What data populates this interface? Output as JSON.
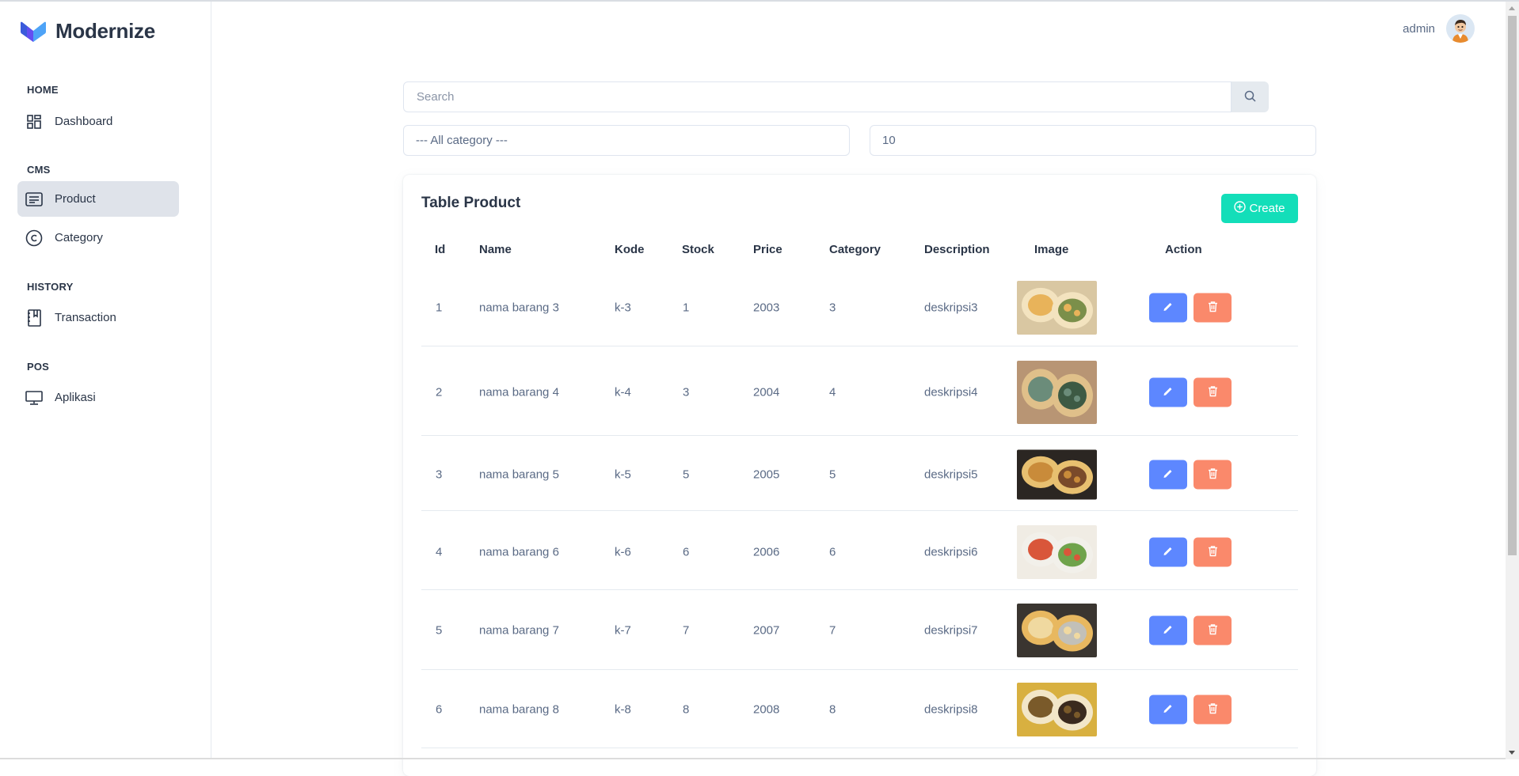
{
  "brand": {
    "name": "Modernize"
  },
  "user": {
    "name": "admin"
  },
  "sidebar": {
    "sections": [
      {
        "label": "HOME",
        "items": [
          {
            "label": "Dashboard",
            "icon": "dashboard-icon"
          }
        ]
      },
      {
        "label": "CMS",
        "items": [
          {
            "label": "Product",
            "icon": "article-icon",
            "active": true
          },
          {
            "label": "Category",
            "icon": "copyright-icon"
          }
        ]
      },
      {
        "label": "HISTORY",
        "items": [
          {
            "label": "Transaction",
            "icon": "book-icon"
          }
        ]
      },
      {
        "label": "POS",
        "items": [
          {
            "label": "Aplikasi",
            "icon": "monitor-icon"
          }
        ]
      }
    ]
  },
  "filters": {
    "search_placeholder": "Search",
    "category_select": "--- All category ---",
    "limit_value": "10"
  },
  "table": {
    "title": "Table Product",
    "create_label": "Create",
    "columns": [
      "Id",
      "Name",
      "Kode",
      "Stock",
      "Price",
      "Category",
      "Description",
      "Image",
      "Action"
    ],
    "rows": [
      {
        "id": "1",
        "name": "nama barang 3",
        "kode": "k-3",
        "stock": "1",
        "price": "2003",
        "category": "3",
        "description": "deskripsi3"
      },
      {
        "id": "2",
        "name": "nama barang 4",
        "kode": "k-4",
        "stock": "3",
        "price": "2004",
        "category": "4",
        "description": "deskripsi4"
      },
      {
        "id": "3",
        "name": "nama barang 5",
        "kode": "k-5",
        "stock": "5",
        "price": "2005",
        "category": "5",
        "description": "deskripsi5"
      },
      {
        "id": "4",
        "name": "nama barang 6",
        "kode": "k-6",
        "stock": "6",
        "price": "2006",
        "category": "6",
        "description": "deskripsi6"
      },
      {
        "id": "5",
        "name": "nama barang 7",
        "kode": "k-7",
        "stock": "7",
        "price": "2007",
        "category": "7",
        "description": "deskripsi7"
      },
      {
        "id": "6",
        "name": "nama barang 8",
        "kode": "k-8",
        "stock": "8",
        "price": "2008",
        "category": "8",
        "description": "deskripsi8"
      }
    ]
  },
  "colors": {
    "primary": "#5d87ff",
    "success": "#13deb9",
    "danger": "#fa896b",
    "text": "#2a3547",
    "muted": "#5a6a85"
  }
}
